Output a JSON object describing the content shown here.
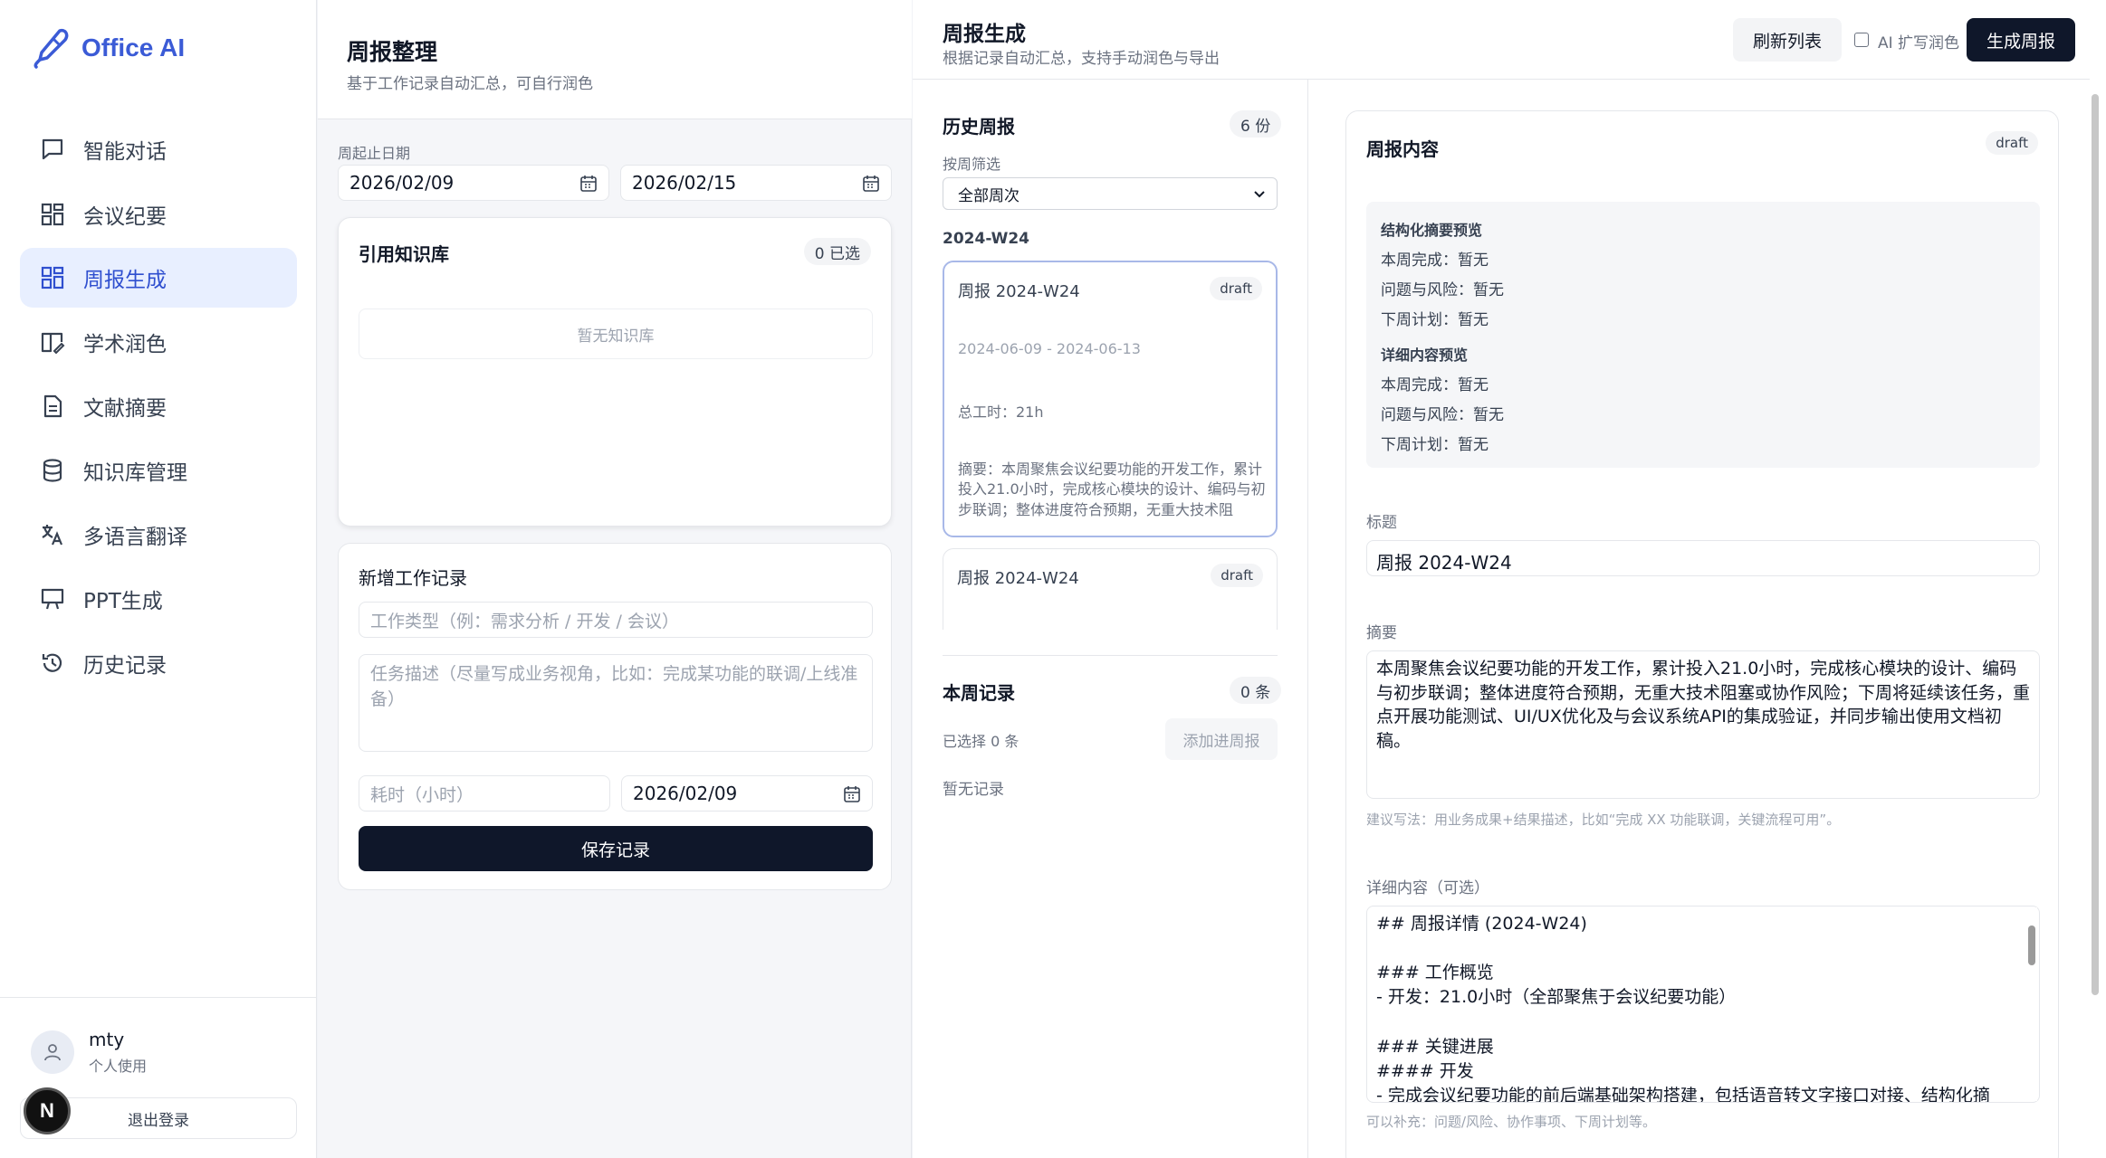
{
  "app": {
    "name": "Office AI",
    "accent": "#3b5bd6"
  },
  "sidebar": {
    "items": [
      {
        "label": "智能对话",
        "icon": "chat-icon"
      },
      {
        "label": "会议纪要",
        "icon": "grid-icon"
      },
      {
        "label": "周报生成",
        "icon": "grid-icon"
      },
      {
        "label": "学术润色",
        "icon": "book-edit-icon"
      },
      {
        "label": "文献摘要",
        "icon": "document-icon"
      },
      {
        "label": "知识库管理",
        "icon": "database-icon"
      },
      {
        "label": "多语言翻译",
        "icon": "translate-icon"
      },
      {
        "label": "PPT生成",
        "icon": "presentation-icon"
      },
      {
        "label": "历史记录",
        "icon": "history-icon"
      }
    ],
    "active": "周报生成",
    "user": {
      "name": "mty",
      "subtitle": "个人使用"
    },
    "logout_label": "退出登录",
    "badge": "N"
  },
  "organize": {
    "title": "周报整理",
    "subtitle": "基于工作记录自动汇总，可自行润色",
    "date_label": "周起止日期",
    "start_date": "2026/02/09",
    "end_date": "2026/02/15",
    "kb": {
      "title": "引用知识库",
      "count": "0 已选",
      "empty": "暂无知识库"
    },
    "new_record": {
      "title": "新增工作记录",
      "type_placeholder": "工作类型（例：需求分析 / 开发 / 会议）",
      "desc_placeholder": "任务描述（尽量写成业务视角，比如：完成某功能的联调/上线准备）",
      "hours_placeholder": "耗时（小时）",
      "date": "2026/02/09",
      "save_label": "保存记录"
    }
  },
  "generate": {
    "title": "周报生成",
    "subtitle": "根据记录自动汇总，支持手动润色与导出",
    "refresh_label": "刷新列表",
    "ai_polish_label": "AI 扩写润色",
    "generate_label": "生成周报",
    "history": {
      "title": "历史周报",
      "count": "6 份",
      "filter_label": "按周筛选",
      "filter_value": "全部周次",
      "group_label": "2024-W24",
      "reports": [
        {
          "title": "周报 2024-W24",
          "status": "draft",
          "range": "2024-06-09 - 2024-06-13",
          "hours": "总工时：21h",
          "summary": "摘要：本周聚焦会议纪要功能的开发工作，累计投入21.0小时，完成核心模块的设计、编码与初步联调；整体进度符合预期，无重大技术阻"
        },
        {
          "title": "周报 2024-W24",
          "status": "draft"
        }
      ]
    },
    "records": {
      "title": "本周记录",
      "count": "0 条",
      "selected": "已选择 0 条",
      "add_label": "添加进周报",
      "empty": "暂无记录"
    },
    "content": {
      "title": "周报内容",
      "status": "draft",
      "structured_title": "结构化摘要预览",
      "structured": [
        "本周完成：暂无",
        "问题与风险：暂无",
        "下周计划：暂无"
      ],
      "detail_title": "详细内容预览",
      "detail": [
        "本周完成：暂无",
        "问题与风险：暂无",
        "下周计划：暂无"
      ],
      "title_label": "标题",
      "title_value": "周报 2024-W24",
      "summary_label": "摘要",
      "summary_value": "本周聚焦会议纪要功能的开发工作，累计投入21.0小时，完成核心模块的设计、编码与初步联调；整体进度符合预期，无重大技术阻塞或协作风险；下周将延续该任务，重点开展功能测试、UI/UX优化及与会议系统API的集成验证，并同步输出使用文档初稿。",
      "summary_hint": "建议写法：用业务成果+结果描述，比如“完成 XX 功能联调，关键流程可用”。",
      "detail_label": "详细内容（可选）",
      "detail_value": "## 周报详情 (2024-W24)\n\n### 工作概览\n- 开发：21.0小时（全部聚焦于会议纪要功能）\n\n### 关键进展\n#### 开发\n- 完成会议纪要功能的前后端基础架构搭建，包括语音转文字接口对接、结构化摘",
      "detail_hint": "可以补充：问题/风险、协作事项、下周计划等。"
    }
  }
}
